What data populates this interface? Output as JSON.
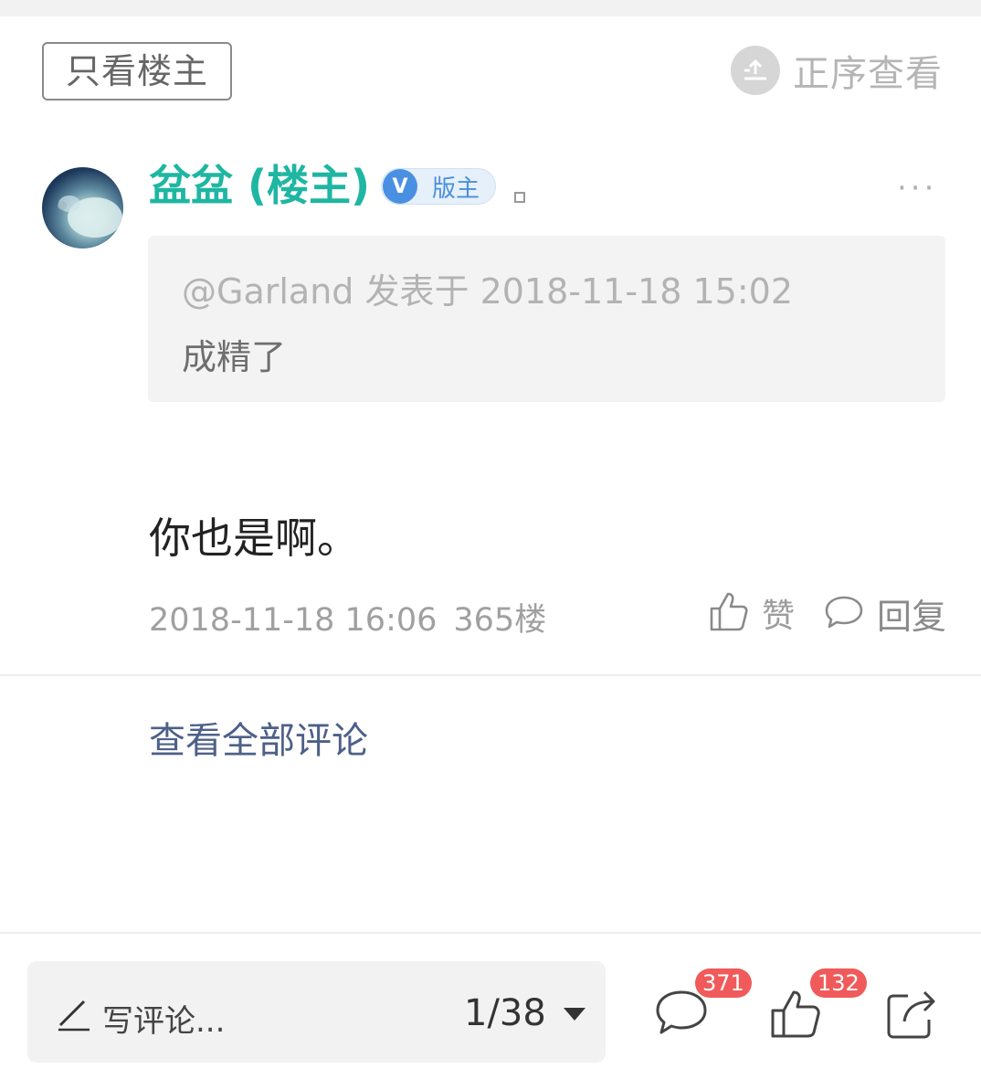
{
  "header": {
    "only_op_label": "只看楼主",
    "sort_label": "正序查看"
  },
  "post": {
    "author": "盆盆 (楼主)",
    "badge_letter": "V",
    "badge_label": "版主",
    "title_suffix": "。",
    "quote": {
      "meta": "@Garland 发表于 2018-11-18 15:02",
      "text": "成精了"
    },
    "content": "你也是啊。",
    "timestamp": "2018-11-18 16:06",
    "floor": "365楼",
    "like_label": "赞",
    "reply_label": "回复"
  },
  "view_all_comments": "查看全部评论",
  "bottom_bar": {
    "comment_placeholder": "写评论...",
    "page_indicator": "1/38",
    "comment_count": "371",
    "like_count": "132"
  },
  "colors": {
    "accent_teal": "#1fb6a2",
    "link_blue_gray": "#4d6088",
    "badge_blue": "#4a90e2",
    "count_red": "#f05a5a"
  },
  "icons": [
    "sort-up-icon",
    "more-icon",
    "thumbs-up-icon",
    "comment-icon",
    "pen-icon",
    "caret-down-icon",
    "share-icon"
  ]
}
